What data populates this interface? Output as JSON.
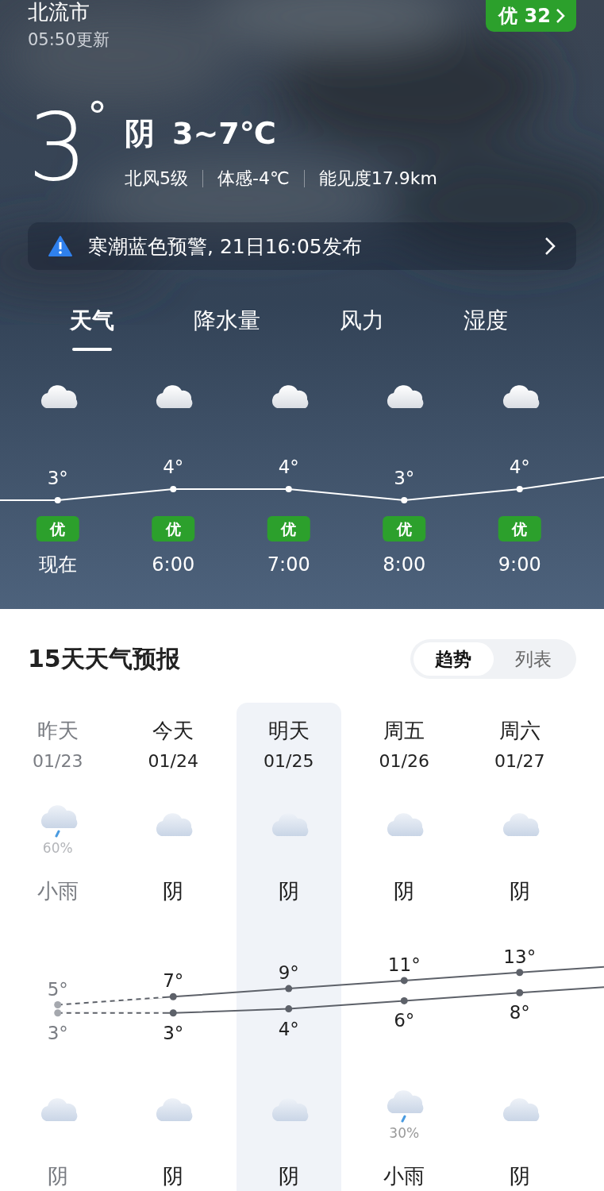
{
  "header": {
    "city": "北流市",
    "updated": "05:50更新",
    "aqi_badge": "优 32"
  },
  "current": {
    "temp": "3",
    "degree": "°",
    "condition": "阴",
    "range": "3~7℃",
    "details": [
      "北风5级",
      "体感-4℃",
      "能见度17.9km"
    ]
  },
  "alert": {
    "text": "寒潮蓝色预警, 21日16:05发布"
  },
  "tabs": [
    {
      "label": "天气",
      "selected": true
    },
    {
      "label": "降水量",
      "selected": false
    },
    {
      "label": "风力",
      "selected": false
    },
    {
      "label": "湿度",
      "selected": false
    }
  ],
  "hourly": {
    "items": [
      {
        "kind": "cloudy",
        "aqi": "优"
      },
      {
        "kind": "cloudy",
        "aqi": "优"
      },
      {
        "kind": "cloudy",
        "aqi": "优"
      },
      {
        "kind": "cloudy",
        "aqi": "优"
      },
      {
        "kind": "cloudy",
        "aqi": "优"
      }
    ],
    "chart_data": {
      "type": "line",
      "categories": [
        "现在",
        "6:00",
        "7:00",
        "8:00",
        "9:00"
      ],
      "marker": "circle",
      "values": [
        3,
        4,
        4,
        3,
        4
      ],
      "value_labels": [
        "3°",
        "4°",
        "4°",
        "3°",
        "4°"
      ]
    }
  },
  "forecast": {
    "title": "15天天气预报",
    "views": [
      {
        "label": "趋势",
        "selected": true
      },
      {
        "label": "列表",
        "selected": false
      }
    ],
    "days": [
      {
        "date": "01/23",
        "past": true,
        "selected": false,
        "day": {
          "kind": "rain",
          "precip": "60%",
          "condition": "小雨"
        },
        "night": {
          "kind": "cloudy",
          "condition": "阴"
        }
      },
      {
        "date": "01/24",
        "past": false,
        "selected": false,
        "day": {
          "kind": "cloudy",
          "condition": "阴"
        },
        "night": {
          "kind": "cloudy",
          "condition": "阴"
        }
      },
      {
        "date": "01/25",
        "past": false,
        "selected": true,
        "day": {
          "kind": "cloudy",
          "condition": "阴"
        },
        "night": {
          "kind": "cloudy",
          "condition": "阴"
        }
      },
      {
        "date": "01/26",
        "past": false,
        "selected": false,
        "day": {
          "kind": "cloudy",
          "condition": "阴"
        },
        "night": {
          "kind": "rain",
          "precip": "30%",
          "condition": "小雨"
        }
      },
      {
        "date": "01/27",
        "past": false,
        "selected": false,
        "day": {
          "kind": "cloudy",
          "condition": "阴"
        },
        "night": {
          "kind": "cloudy",
          "condition": "阴"
        }
      }
    ],
    "chart_data": {
      "type": "line",
      "categories": [
        "昨天",
        "今天",
        "明天",
        "周五",
        "周六"
      ],
      "marker": "circle",
      "series": [
        {
          "color": "#5d6169",
          "values": [
            5,
            7,
            9,
            11,
            13
          ],
          "value_labels": [
            "5°",
            "7°",
            "9°",
            "11°",
            "13°"
          ]
        },
        {
          "color": "#5d6169",
          "values": [
            3,
            3,
            4,
            6,
            8
          ],
          "value_labels": [
            "3°",
            "3°",
            "4°",
            "6°",
            "8°"
          ]
        }
      ]
    }
  }
}
